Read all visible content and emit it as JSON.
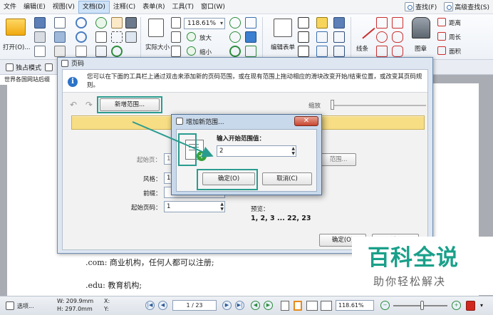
{
  "menubar": {
    "items": [
      "文件",
      "编辑(E)",
      "视图(V)",
      "文档(D)",
      "注释(C)",
      "表单(R)",
      "工具(T)",
      "窗口(W)"
    ],
    "active_index": 3,
    "find": "查找(F)",
    "advanced_find": "高级查找(S)"
  },
  "ribbon": {
    "open": "打开(O)...",
    "actual_size": "实际大小",
    "zoom_value": "118.61%",
    "zoom_in": "放大",
    "zoom_out": "缩小",
    "edit_form": "编辑表单",
    "lines": "线条",
    "stamp": "图章",
    "distance": "距离",
    "perimeter": "周长",
    "area": "面积"
  },
  "tabs": {
    "mode": "独占模式",
    "doc_title": "世界各国网站后缀"
  },
  "document": {
    "line1": ".com: 商业机构，任何人都可以注册;",
    "line2": ".edu: 教育机构;"
  },
  "page_dialog": {
    "title": "页码",
    "info": "您可以在下面的工具栏上通过双击来添加新的页码范围，或在现有范围上拖动相应的滑块改变开始/结束位置，或改变其页码规则。",
    "add_range_button": "新增范围...",
    "zoom_label": "缩放",
    "start_page_label": "起始页：",
    "start_page_value": "1",
    "range_button": "范围...",
    "style_label": "风格：",
    "style_value": "1,",
    "prefix_label": "前缀：",
    "prefix_value": "",
    "start_number_label": "起始页码：",
    "start_number_value": "1",
    "preview_label": "预览：",
    "preview_value": "1, 2, 3 ... 22, 23",
    "ok_button": "确定(O)",
    "cancel_button": "取消(C)"
  },
  "add_range_dialog": {
    "title": "增加新范围...",
    "prompt": "输入开始范围值：",
    "value": "2",
    "ok_button": "确定(O)",
    "cancel_button": "取消(C)"
  },
  "statusbar": {
    "options": "选项...",
    "width": "W: 209.9mm",
    "height": "H: 297.0mm",
    "x": "X:",
    "y": "Y:",
    "page_indicator": "1 / 23",
    "zoom": "118.61%"
  },
  "watermark": {
    "main": "百科全说",
    "sub": "助你轻松解决"
  },
  "colors": {
    "highlight": "#2a9c8f",
    "range_bar": "#f7dd84",
    "watermark": "#1aa08a"
  }
}
